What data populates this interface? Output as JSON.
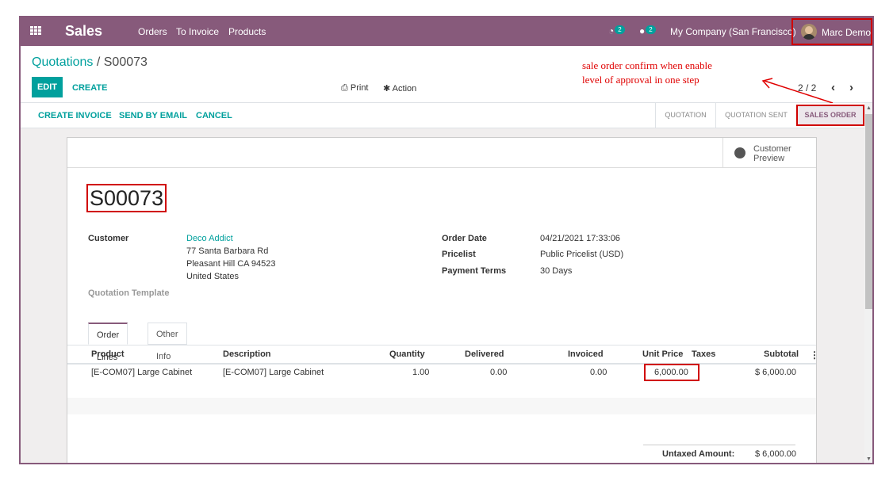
{
  "navbar": {
    "app_title": "Sales",
    "menu": [
      "Orders",
      "To Invoice",
      "Products"
    ],
    "activity_count": "2",
    "message_count": "2",
    "company": "My Company (San Francisco)",
    "user": "Marc Demo"
  },
  "breadcrumb": {
    "parent": "Quotations",
    "separator": "/",
    "current": "S00073"
  },
  "buttons": {
    "edit": "EDIT",
    "create": "CREATE"
  },
  "toolbar": {
    "print": "Print",
    "action": "Action"
  },
  "pager": {
    "value": "2 / 2"
  },
  "annotation": {
    "line1": "sale order confirm when enable",
    "line2": "level of approval in one step"
  },
  "status_actions": [
    "CREATE INVOICE",
    "SEND BY EMAIL",
    "CANCEL"
  ],
  "stages": [
    "QUOTATION",
    "QUOTATION SENT",
    "SALES ORDER"
  ],
  "current_stage": "SALES ORDER",
  "preview": {
    "line1": "Customer",
    "line2": "Preview"
  },
  "order": {
    "name": "S00073",
    "customer_label": "Customer",
    "customer_name": "Deco Addict",
    "address1": "77 Santa Barbara Rd",
    "address2": "Pleasant Hill CA 94523",
    "address3": "United States",
    "template_label": "Quotation Template",
    "date_label": "Order Date",
    "date": "04/21/2021 17:33:06",
    "pricelist_label": "Pricelist",
    "pricelist": "Public Pricelist (USD)",
    "terms_label": "Payment Terms",
    "terms": "30 Days"
  },
  "tabs": [
    "Order Lines",
    "Other Info"
  ],
  "table": {
    "headers": [
      "Product",
      "Description",
      "Quantity",
      "Delivered",
      "Invoiced",
      "Unit Price",
      "Taxes",
      "Subtotal"
    ],
    "rows": [
      {
        "product": "[E-COM07] Large Cabinet",
        "description": "[E-COM07] Large Cabinet",
        "quantity": "1.00",
        "delivered": "0.00",
        "invoiced": "0.00",
        "unit_price": "6,000.00",
        "taxes": "",
        "subtotal": "$ 6,000.00"
      }
    ]
  },
  "totals": {
    "untaxed_label": "Untaxed Amount:",
    "untaxed": "$ 6,000.00"
  },
  "colors": {
    "brand": "#875a7b",
    "accent": "#00a09d",
    "highlight": "#d00000"
  }
}
